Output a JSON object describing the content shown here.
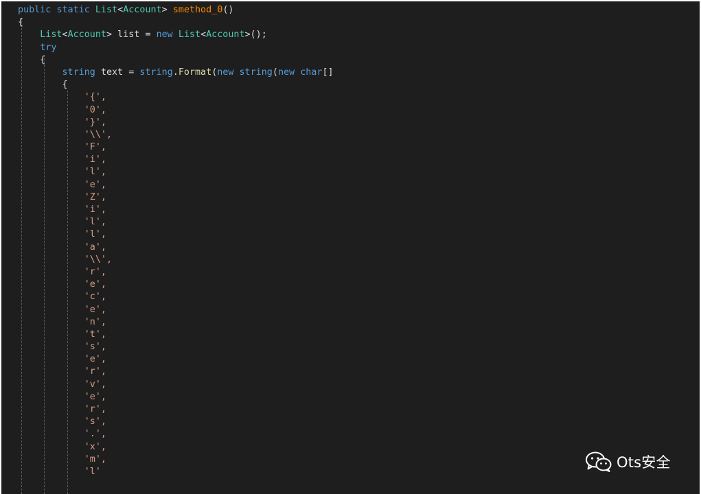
{
  "code": {
    "line_signature": {
      "public": "public",
      "static": "static",
      "ret_type": "List",
      "generic": "Account",
      "method": "smethod_0",
      "parens": "()"
    },
    "line_brace_open": "{",
    "line_list_decl": {
      "type": "List",
      "generic": "Account",
      "var": "list",
      "eq": "=",
      "new": "new",
      "new_type": "List",
      "new_generic": "Account",
      "tail": "();"
    },
    "line_try": "try",
    "line_try_brace": "{",
    "line_string_decl": {
      "type": "string",
      "var": "text",
      "eq": "=",
      "recv": "string",
      "method": "Format",
      "new1": "new",
      "type2": "string",
      "new2": "new",
      "type3": "char",
      "brackets": "[]"
    },
    "line_array_brace": "{",
    "chars": [
      "'{',",
      "'0',",
      "'}',",
      "'\\\\',",
      "'F',",
      "'i',",
      "'l',",
      "'e',",
      "'Z',",
      "'i',",
      "'l',",
      "'l',",
      "'a',",
      "'\\\\',",
      "'r',",
      "'e',",
      "'c',",
      "'e',",
      "'n',",
      "'t',",
      "'s',",
      "'e',",
      "'r',",
      "'v',",
      "'e',",
      "'r',",
      "'s',",
      "'.',",
      "'x',",
      "'m',",
      "'l'"
    ]
  },
  "watermark": {
    "icon": "wechat-icon",
    "text": "Ots安全"
  },
  "colors": {
    "background": "#1e1e1e",
    "keyword": "#569cd6",
    "type": "#4ec9b0",
    "method_highlight": "#ff8c00",
    "method": "#dcdcaa",
    "char_literal": "#d69d85",
    "text": "#dcdcdc"
  }
}
